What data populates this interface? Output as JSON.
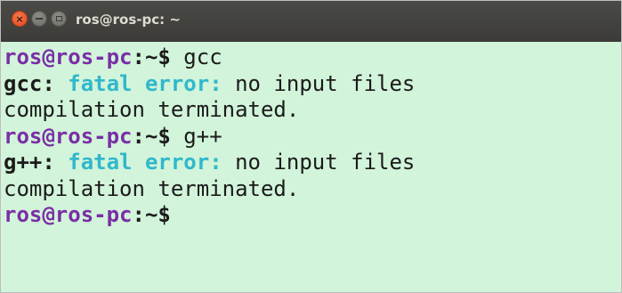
{
  "window": {
    "title": "ros@ros-pc: ~",
    "close_symbol": "×",
    "icons": [
      "close-icon",
      "minimize-icon",
      "maximize-icon"
    ]
  },
  "terminal": {
    "colors": {
      "background": "#d2f4da",
      "prompt_user": "#7a2ea6",
      "error": "#2fb8cc",
      "text": "#1b1b1b"
    },
    "lines": [
      {
        "type": "prompt",
        "user": "ros@ros-pc",
        "path": ":~$",
        "command": " gcc"
      },
      {
        "type": "error",
        "program": "gcc:",
        "label": " fatal error:",
        "message": " no input files"
      },
      {
        "type": "output",
        "text": "compilation terminated."
      },
      {
        "type": "prompt",
        "user": "ros@ros-pc",
        "path": ":~$",
        "command": " g++"
      },
      {
        "type": "error",
        "program": "g++:",
        "label": " fatal error:",
        "message": " no input files"
      },
      {
        "type": "output",
        "text": "compilation terminated."
      },
      {
        "type": "prompt",
        "user": "ros@ros-pc",
        "path": ":~$",
        "command": ""
      }
    ]
  }
}
